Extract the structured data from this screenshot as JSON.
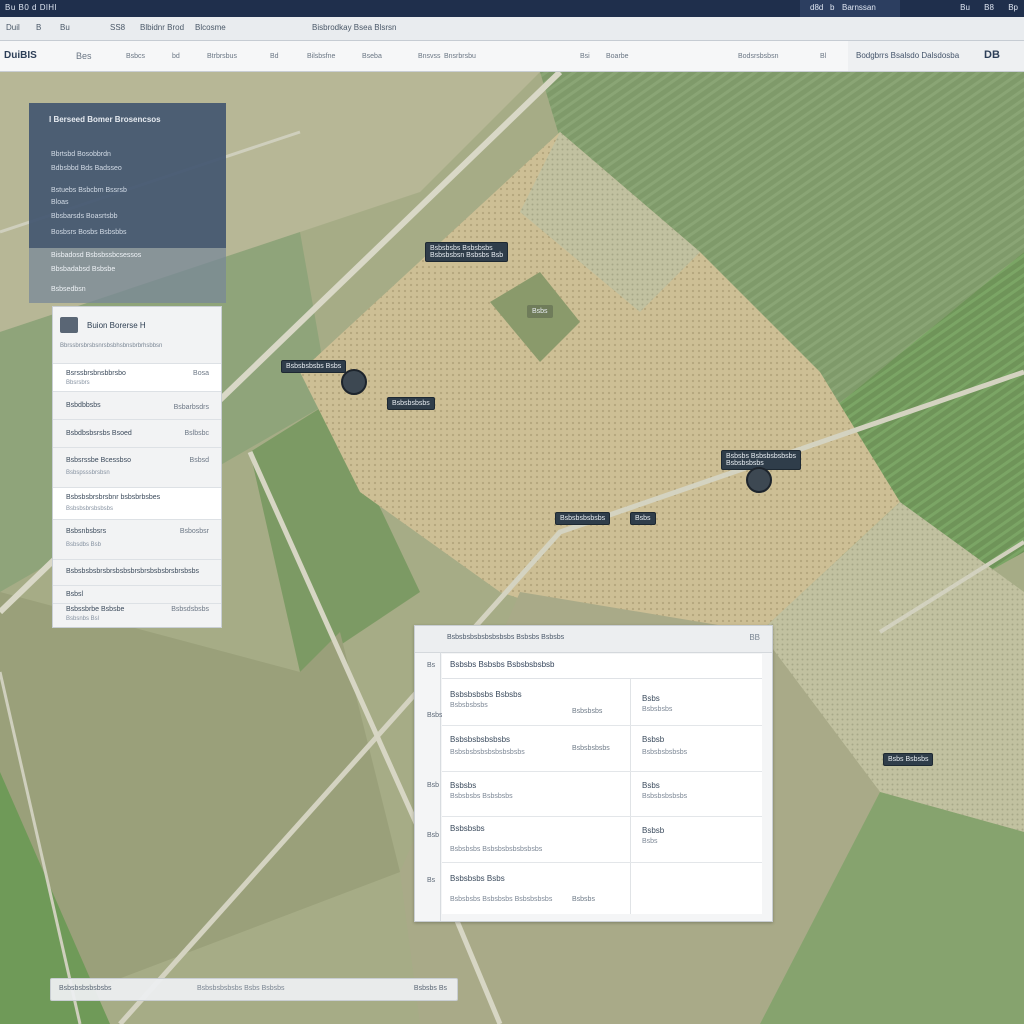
{
  "titlebar": {
    "app_title": "Bu B0 d DlHl",
    "right_box": [
      "d8d",
      "b",
      "Barnssan"
    ],
    "icons": [
      "Bu",
      "B8",
      "Bp"
    ]
  },
  "tabbar": {
    "tabs": [
      "Duil",
      "B",
      "Bu",
      "SS8",
      "Blbidnr Brod",
      "Blcosme",
      "Bisbrodkay Bsea Blsrsn"
    ]
  },
  "toolbar": {
    "logo": "DuiBIS",
    "items": [
      "Bes",
      "Bsbcs",
      "bd",
      "Btrbrsbus",
      "Bd",
      "Bilsbsfne",
      "Bseba",
      "Bnsvss",
      "Bnsrbrsbu",
      "Bsi",
      "Boarbe",
      "Bodsrsbsbsn",
      "Bl"
    ],
    "right_text": "Bodgbrrs Bsalsdo Dalsdosba",
    "right_code": "DB"
  },
  "dark_panel": {
    "title": "I  Berseed Bomer Brosencsos",
    "lines": [
      "Bbrtsbd Bosobbrdn",
      "Bdbsbbd  Bds  Badsseo",
      "Bstuebs Bsbcbm Bssrsb",
      "Bloas",
      "Bbsbarsds Boasrtsbb",
      "Bosbsrs Bosbs Bsbsbbs"
    ],
    "ext_lines": [
      "Bisbadosd Bsbsbssbcsessos",
      "Bbsbadabsd Bsbsbe",
      "Bsbsedbsn"
    ]
  },
  "list_panel": {
    "title": "Buion Borerse H",
    "subtitle": "Bbrssbrsbrsbsnrsbsbhsbnsbrbrhsbbsn",
    "rows": [
      {
        "a": "Bsrssbrsbnsbbrsbo",
        "b": "Bosa",
        "c": "Bbsrsbrs"
      },
      {
        "a": "Bsbdbbsbs",
        "b": "Bsbarbsdrs",
        "c": ""
      },
      {
        "a": "Bsbdbsbsrsbs Bsoed",
        "b": "Bslbsbc",
        "c": ""
      },
      {
        "a": "Bsbsrssbe Bcessbso",
        "b": "Bsbsd",
        "c": "Bsbspsssbrsbsn"
      },
      {
        "a": "Bsbsbsbrsbrsbnr bsbsbrbsbes",
        "b": "",
        "c": "Bsbsbsbrsbsbsbs"
      },
      {
        "a": "Bsbsnbsbsrs",
        "b": "Bsbosbsr",
        "c": "Bsbsdbs Bsb"
      },
      {
        "a": "Bsbsbsbsbrsbrsbsbsbrsbrsbsbsbrsbrsbsbs",
        "b": "",
        "c": ""
      },
      {
        "a": "Bsbsl",
        "b": "",
        "c": ""
      },
      {
        "a": "Bsbssbrbe Bsbsbe",
        "b": "Bsbsdsbsbs",
        "c": "Bsbsnbs Bsl"
      }
    ]
  },
  "map_labels": [
    {
      "text": "Bsbsbsbs Bsbsbsbs",
      "sub": "Bsbsbsbsn Bsbsbs Bsb"
    },
    {
      "text": "Bsbsbsbsbs Bsbs",
      "sub": ""
    },
    {
      "text": "Bsbsbsbsbs",
      "sub": ""
    },
    {
      "text": "Bsbsbs Bsbsbsbsbsbs",
      "sub": "Bsbsbsbsbs"
    },
    {
      "text": "Bsbsbsbsbsbs",
      "sub": ""
    },
    {
      "text": "Bsbs",
      "sub": ""
    },
    {
      "text": "Bsbs Bsbsbs",
      "sub": ""
    },
    {
      "text": "Bsbs",
      "sub": ""
    }
  ],
  "detail_panel": {
    "header": "Bsbsbsbsbsbsbsbsbs  Bsbsbs  Bsbsbs",
    "close": "BB",
    "side_labels": [
      "Bs",
      "Bsbs",
      "Bsb",
      "Bsb",
      "Bs"
    ],
    "table_head": "Bsbsbs Bsbsbs Bsbsbsbsbsb",
    "rows": [
      {
        "c1": "Bsbsbsbsbs Bsbsbs",
        "c1s": "Bsbsbsbsbs",
        "c2": "Bsbsbsbs",
        "c3": "Bsbs",
        "c3s": "Bsbsbsbs"
      },
      {
        "c1": "Bsbsbsbsbsbsbs",
        "c1s": "Bsbsbsbsbsbsbsbsbsbs",
        "c2": "Bsbsbsbsbs",
        "c3": "Bsbsb",
        "c3s": "Bsbsbsbsbsbs"
      },
      {
        "c1": "Bsbsbs",
        "c1s": "Bsbsbsbs  Bsbsbsbs",
        "c2": "",
        "c3": "Bsbs",
        "c3s": "Bsbsbsbsbsbs"
      },
      {
        "c1": "Bsbsbsbs",
        "c1s": "Bsbsbsbs Bsbsbsbsbsbsbsbs",
        "c2": "",
        "c3": "Bsbsb",
        "c3s": "Bsbs"
      },
      {
        "c1": "Bsbsbsbs Bsbs",
        "c1s": "Bsbsbsbs Bsbsbsbs Bsbsbsbsbs",
        "c2": "Bsbsbs",
        "c3": "",
        "c3s": ""
      }
    ]
  },
  "statusbar": {
    "left": "Bsbsbsbsbsbsbs",
    "mid": "Bsbsbsbsbsbs Bsbs Bsbsbs",
    "right": "Bsbsbs Bs"
  },
  "colors": {
    "titlebar": "#1f2f4c",
    "field_green": "#7f9a6a",
    "field_tan": "#c9bd93",
    "road": "#d8d6c4",
    "panel_dark": "#425670"
  }
}
